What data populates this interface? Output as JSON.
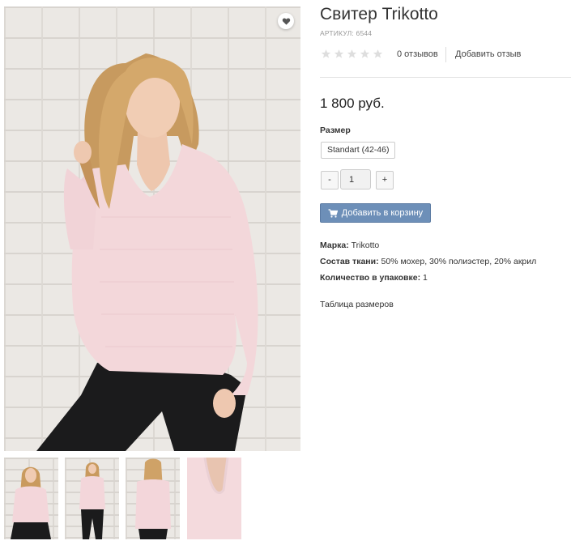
{
  "product": {
    "title": "Свитер Trikotto",
    "sku": "АРТИКУЛ: 6544",
    "reviews_count": "0 отзывов",
    "add_review": "Добавить отзыв",
    "rating": 0,
    "rating_max": 5,
    "price": "1 800 руб.",
    "size_label": "Размер",
    "size_option": "Standart (42-46)",
    "qty_minus": "-",
    "qty_value": "1",
    "qty_plus": "+",
    "add_to_cart": "Добавить в корзину",
    "properties": [
      {
        "label": "Марка:",
        "value": "Trikotto"
      },
      {
        "label": "Состав ткани:",
        "value": "50% мохер, 30% полиэстер, 20% акрил"
      },
      {
        "label": "Количество в упаковке:",
        "value": "1"
      }
    ],
    "size_table_link": "Таблица размеров"
  },
  "gallery": {
    "icons": {
      "wishlist": "heart-icon",
      "cart": "cart-icon",
      "rating": "star-icon"
    },
    "thumbnails": [
      "model-front-view",
      "model-front-full",
      "model-back-view",
      "neckline-detail"
    ]
  },
  "colors": {
    "sweater": "#f3d6da",
    "pants": "#1a1a1a",
    "hair": "#c99a5e",
    "cart_button": "#6d8fb8",
    "star_empty": "#dedede"
  }
}
